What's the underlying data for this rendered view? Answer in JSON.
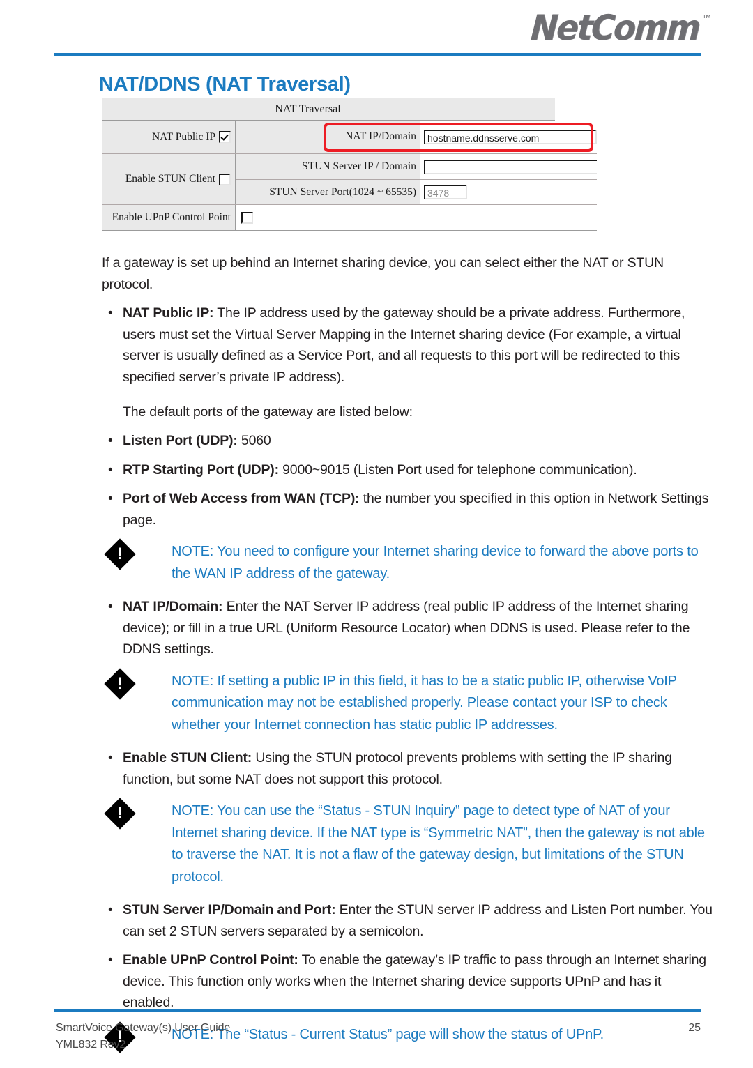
{
  "header": {
    "logo_text": "NetComm",
    "logo_tm": "™",
    "page_title": "NAT/DDNS (NAT Traversal)",
    "accent_color": "#1b7bc0"
  },
  "form_screenshot": {
    "table_title": "NAT Traversal",
    "highlight_color": "#ed1c24",
    "rows": {
      "nat_public_ip_label": "NAT Public IP",
      "nat_public_ip_checked": true,
      "nat_ip_domain_label": "NAT IP/Domain",
      "nat_ip_domain_value": "hostname.ddnsserve.com",
      "enable_stun_client_label": "Enable STUN Client",
      "enable_stun_client_checked": false,
      "stun_server_ip_label": "STUN Server IP / Domain",
      "stun_server_ip_value": "",
      "stun_server_port_label": "STUN Server Port(1024 ~ 65535)",
      "stun_server_port_value": "3478",
      "enable_upnp_label": "Enable UPnP Control Point",
      "enable_upnp_checked": false
    }
  },
  "body": {
    "intro": "If a gateway is set up behind an Internet sharing device, you can select either the NAT or STUN protocol.",
    "bullet_dot": "•",
    "nat_public_ip": {
      "term": "NAT Public IP:",
      "text": " The IP address used by the gateway should be a private address. Furthermore, users must set the Virtual Server Mapping in the Internet sharing device (For example, a virtual server is usually defined as a Service Port, and all requests to this port will be redirected to this specified server’s private IP address)."
    },
    "default_ports_intro": "The default ports of the gateway are listed below:",
    "listen_port": {
      "term": "Listen Port (UDP):",
      "text": " 5060"
    },
    "rtp_port": {
      "term": "RTP Starting Port (UDP):",
      "text": " 9000~9015 (Listen Port used for telephone communication)."
    },
    "web_access_port": {
      "term": "Port of Web Access from WAN (TCP):",
      "text": " the number you specified in this option in Network Settings page."
    },
    "note_1": "NOTE: You need to configure your Internet sharing device to forward the above ports to the WAN IP address of the gateway.",
    "nat_ip_domain": {
      "term": "NAT IP/Domain:",
      "text": " Enter the NAT Server IP address (real public IP address of the Internet sharing device); or fill in a true URL (Uniform Resource Locator) when DDNS is used. Please refer to the DDNS settings."
    },
    "note_2": "NOTE: If setting a public IP in this field, it has to be a static public IP, otherwise VoIP communication may not be established properly. Please contact your ISP to check whether your Internet connection has static public IP addresses.",
    "enable_stun_client": {
      "term": "Enable STUN Client:",
      "text": " Using the STUN protocol prevents problems with setting the IP sharing function, but some NAT does not support this protocol."
    },
    "note_3": "NOTE: You can use the “Status - STUN Inquiry” page to detect type of NAT of your Internet sharing device. If the NAT type is “Symmetric NAT”, then the gateway is not able to traverse the NAT. It is not a flaw of the gateway design, but limitations of the STUN protocol.",
    "stun_server_ip_port": {
      "term": "STUN Server IP/Domain and Port:",
      "text": " Enter the STUN server IP address and Listen Port number. You can set 2 STUN servers separated by a semicolon."
    },
    "enable_upnp": {
      "term": "Enable UPnP Control Point:",
      "text": " To enable the gateway’s IP traffic to pass through an Internet sharing device. This function only works when the Internet sharing device supports UPnP and has it enabled."
    },
    "note_4": "NOTE: The “Status - Current Status” page will show the status of UPnP.",
    "note_icon_glyph": "!"
  },
  "footer": {
    "line1": "SmartVoice Gateway(s) User Guide",
    "line2": "YML832 Rev2",
    "page_number": "25"
  }
}
